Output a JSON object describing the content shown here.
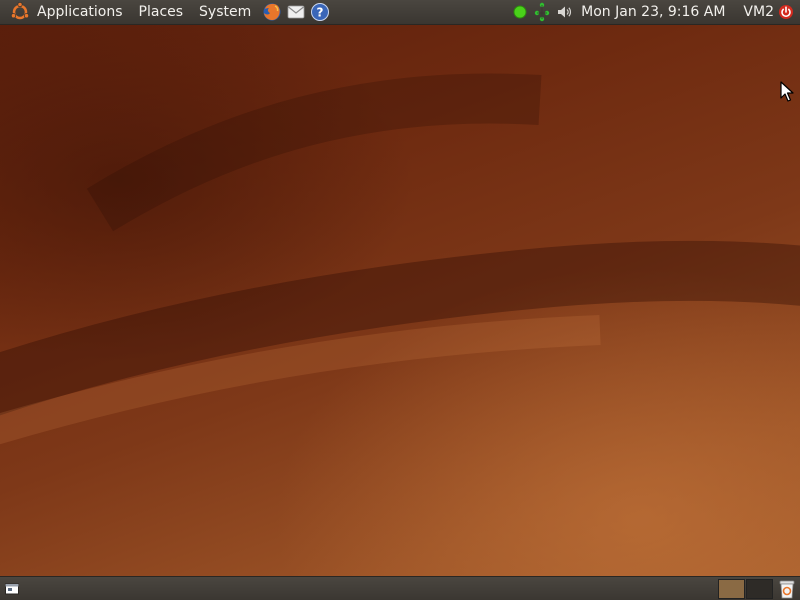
{
  "top_panel": {
    "menus": {
      "applications": "Applications",
      "places": "Places",
      "system": "System"
    },
    "launchers": [
      "firefox-icon",
      "mail-icon",
      "help-icon"
    ],
    "clock": "Mon Jan 23,  9:16 AM",
    "user": "VM2"
  },
  "bottom_panel": {
    "workspaces": 2,
    "active_workspace": 1
  },
  "colors": {
    "panel": "#3f3b36",
    "wallpaper": "#7a3616",
    "network_status": "#4ad11a"
  }
}
